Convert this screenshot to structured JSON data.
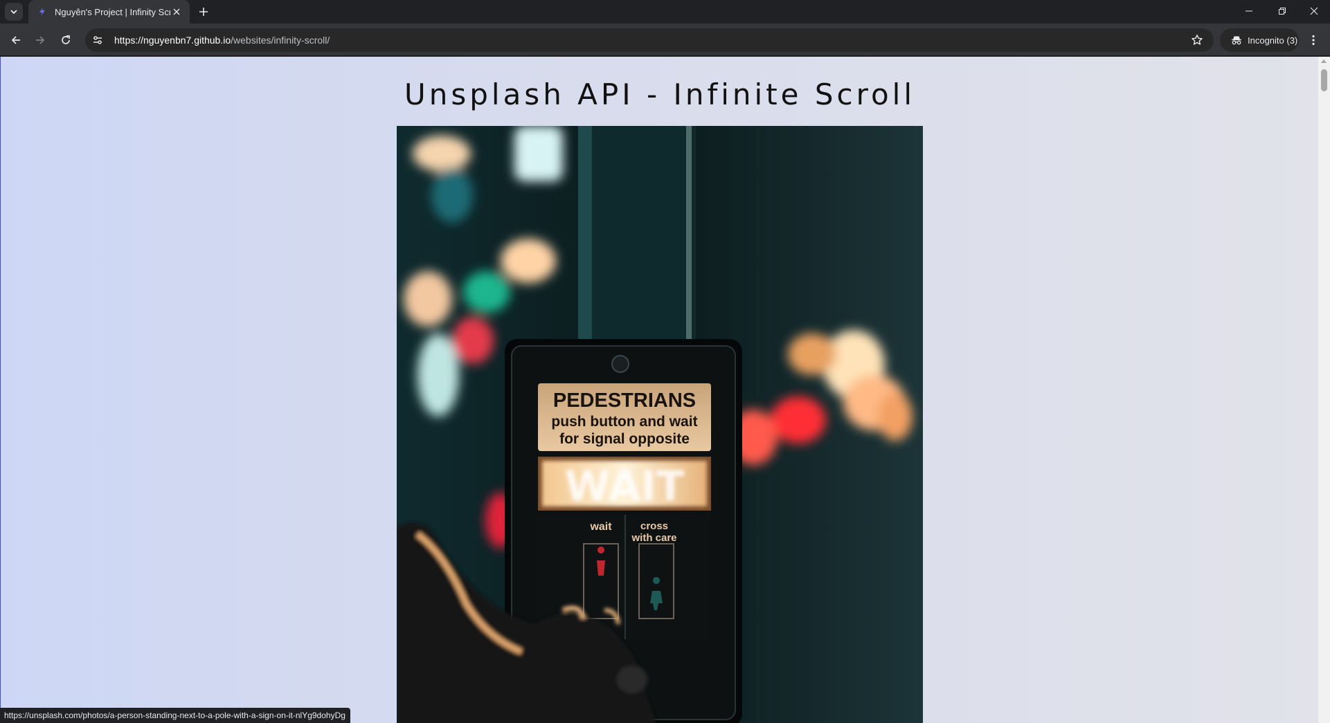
{
  "browser": {
    "tab_title": "Nguyên's Project | Infinity Scroll",
    "url_host": "https://nguyenbn7.github.io",
    "url_path": "/websites/infinity-scroll/",
    "incognito_label": "Incognito (3)",
    "status_url": "https://unsplash.com/photos/a-person-standing-next-to-a-pole-with-a-sign-on-it-nlYg9dohyDg"
  },
  "page": {
    "title": "Unsplash API - Infinite Scroll",
    "photo": {
      "sign_line1": "PEDESTRIANS",
      "sign_line2": "push button and wait",
      "sign_line3": "for signal opposite",
      "signal_text": "WAIT",
      "label_wait": "wait",
      "label_cross_1": "cross",
      "label_cross_2": "with care"
    }
  },
  "icons": {
    "tab_search": "chevron-down-icon",
    "favicon": "lightning-icon",
    "tab_close": "close-icon",
    "new_tab": "plus-icon",
    "back": "arrow-left-icon",
    "forward": "arrow-right-icon",
    "reload": "reload-icon",
    "site_info": "tune-icon",
    "bookmark": "star-icon",
    "incognito": "incognito-icon",
    "menu": "kebab-menu-icon",
    "minimize": "minimize-icon",
    "restore": "restore-icon",
    "close_window": "close-icon"
  },
  "colors": {
    "chrome_dark": "#202124",
    "chrome_toolbar": "#35363a",
    "page_bg_left": "#cdd7f5",
    "page_bg_right": "#e1e2ea"
  }
}
